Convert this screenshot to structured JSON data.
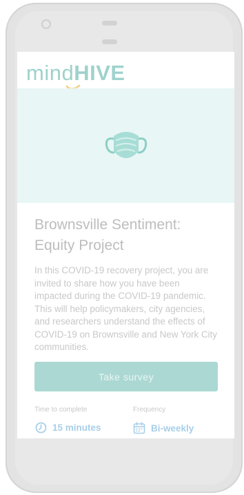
{
  "app": {
    "logo_light": "mind",
    "logo_bold": "HIVE"
  },
  "study": {
    "title": "Brownsville Sentiment: Equity Project",
    "description": "In this COVID-19 recovery project, you are invited to share how you have been impacted during the COVID-19 pandemic. This will help policymakers, city agencies, and researchers understand the effects of COVID-19 on Brownsville and New York City communities.",
    "cta_label": "Take survey",
    "time_label": "Time to complete",
    "time_value": "15 minutes",
    "frequency_label": "Frequency",
    "frequency_value": "Bi-weekly"
  },
  "icons": {
    "hero": "face-mask-icon",
    "time": "clock-icon",
    "frequency": "calendar-icon"
  },
  "colors": {
    "brand": "#9fd2cc",
    "button": "#acd8d3",
    "hero_bg": "#e8f6f5",
    "meta_value": "#a8cfe8"
  }
}
